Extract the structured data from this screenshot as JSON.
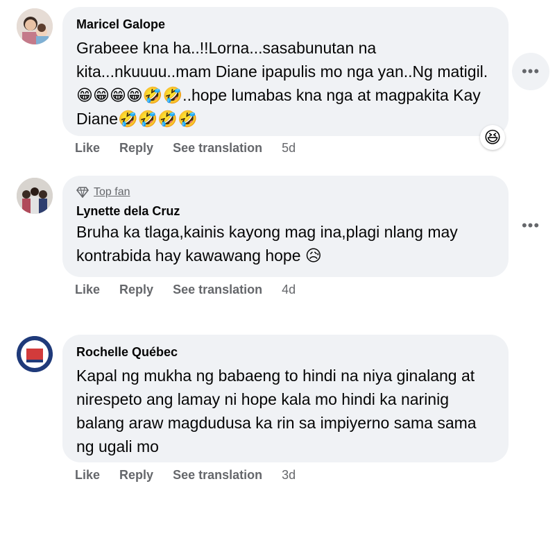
{
  "comments": [
    {
      "author": "Maricel Galope",
      "text": "Grabeee kna ha..!!Lorna...sasabunutan na kita...nkuuuu..mam Diane ipapulis mo nga yan..Ng matigil.😁😁😁😁🤣🤣..hope lumabas kna nga at magpakita Kay Diane🤣🤣🤣🤣",
      "actions": {
        "like": "Like",
        "reply": "Reply",
        "translate": "See translation",
        "time": "5d"
      },
      "reaction": "😆"
    },
    {
      "badge": "Top fan",
      "author": "Lynette dela Cruz",
      "text": "Bruha ka tlaga,kainis kayong mag ina,plagi nlang may kontrabida hay kawawang hope 😥",
      "actions": {
        "like": "Like",
        "reply": "Reply",
        "translate": "See translation",
        "time": "4d"
      }
    },
    {
      "author": "Rochelle Québec",
      "text": "Kapal ng mukha ng babaeng to hindi na niya ginalang at nirespeto ang lamay ni hope kala mo hindi ka narinig balang araw magdudusa ka rin sa impiyerno sama sama ng ugali mo",
      "actions": {
        "like": "Like",
        "reply": "Reply",
        "translate": "See translation",
        "time": "3d"
      }
    }
  ],
  "icons": {
    "more": "more-options-icon",
    "badge": "diamond-icon"
  },
  "colors": {
    "bubble": "#f0f2f5",
    "secondary": "#65676b",
    "text": "#050505"
  }
}
